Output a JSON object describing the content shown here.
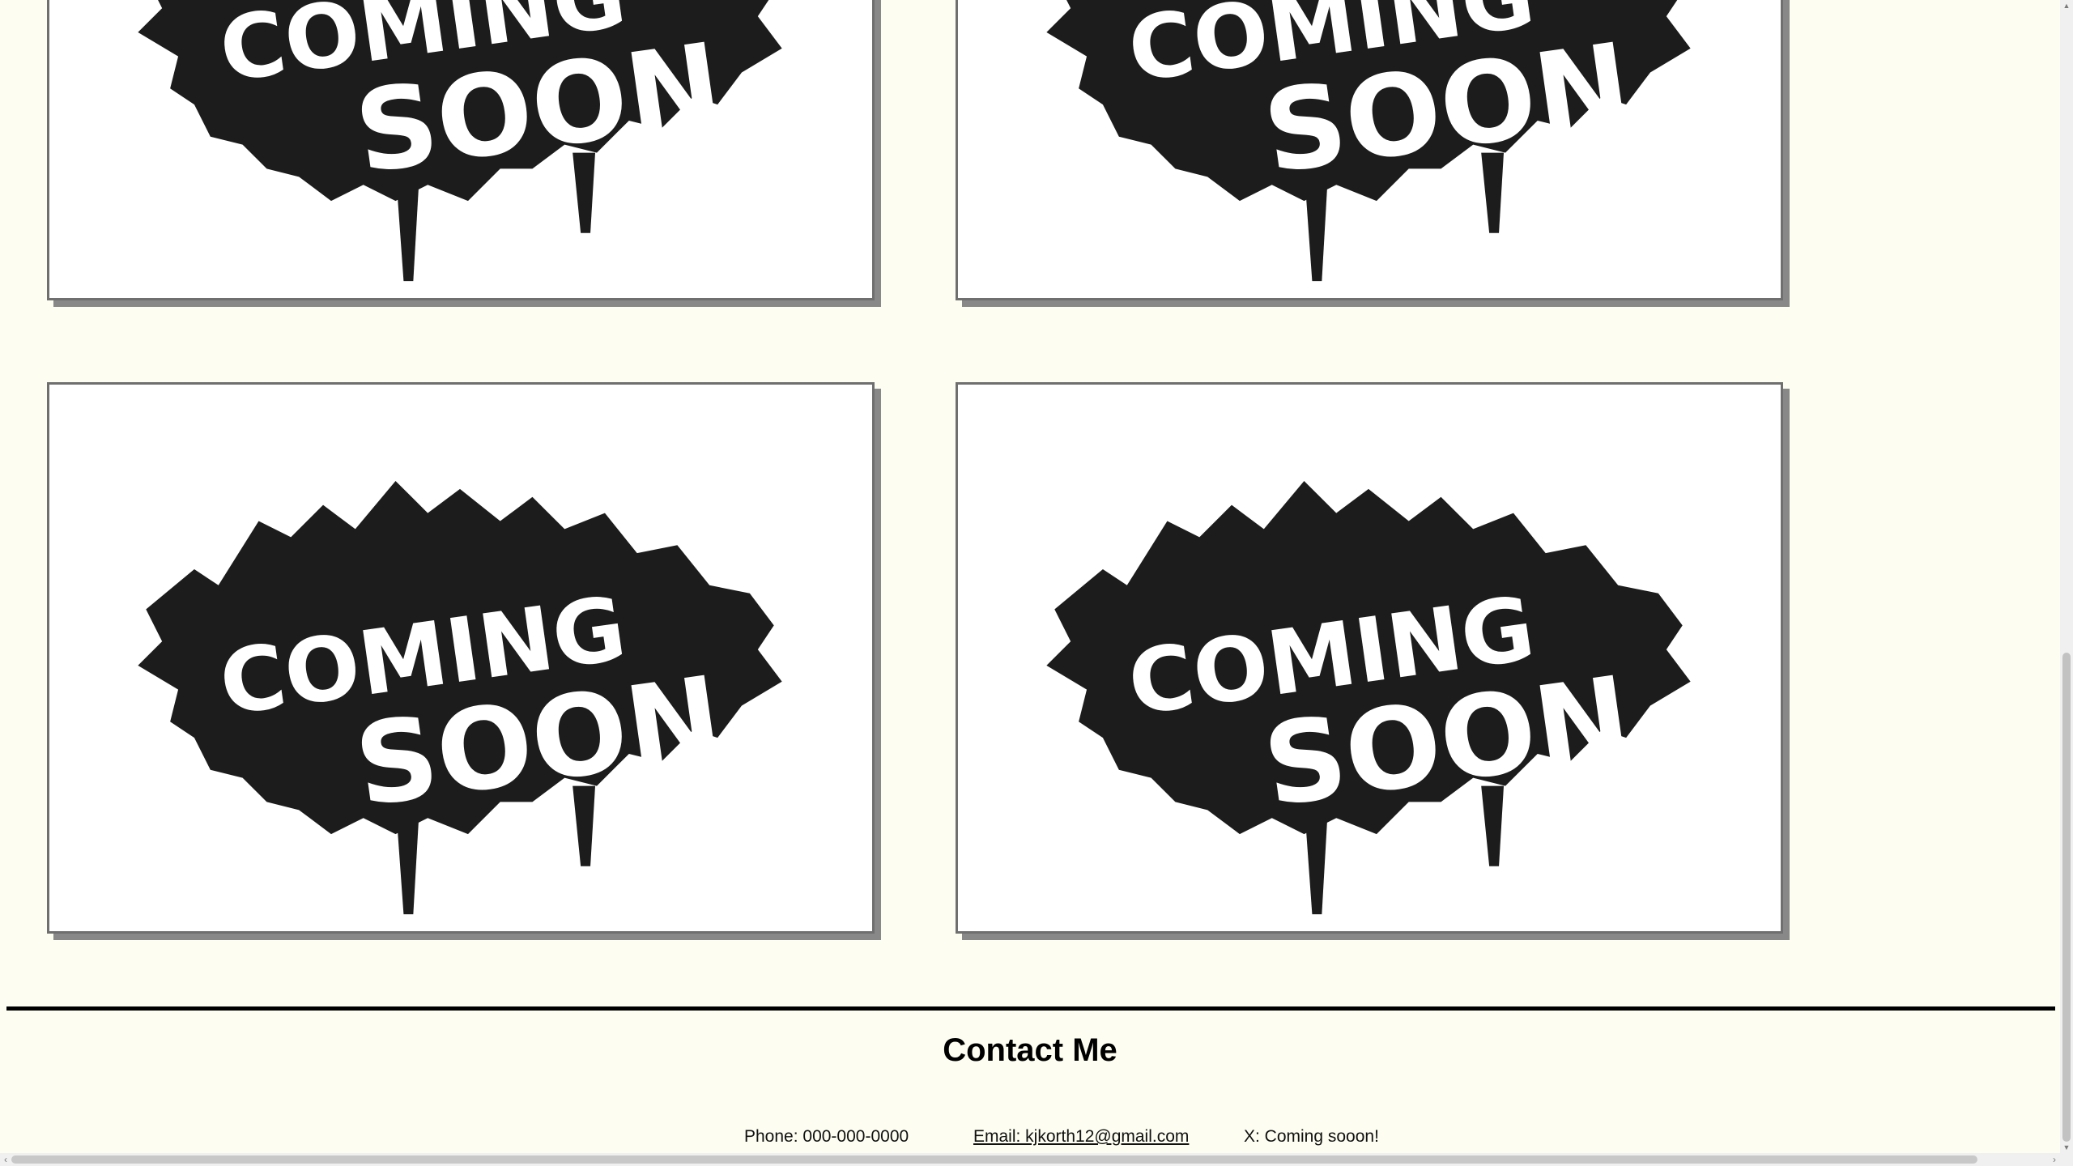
{
  "gallery": {
    "items": [
      {
        "line1": "COMING",
        "line2": "SOON"
      },
      {
        "line1": "COMING",
        "line2": "SOON"
      },
      {
        "line1": "COMING",
        "line2": "SOON"
      },
      {
        "line1": "COMING",
        "line2": "SOON"
      }
    ]
  },
  "contact": {
    "title": "Contact Me",
    "phone": "Phone: 000-000-0000",
    "email": "Email: kjkorth12@gmail.com",
    "x": "X: Coming sooon!"
  },
  "scrollbars": {
    "vertical_thumb_icon": "scroll-thumb",
    "up_arrow": "▲",
    "down_arrow": "▼",
    "left_arrow": "‹",
    "right_arrow": "›"
  }
}
